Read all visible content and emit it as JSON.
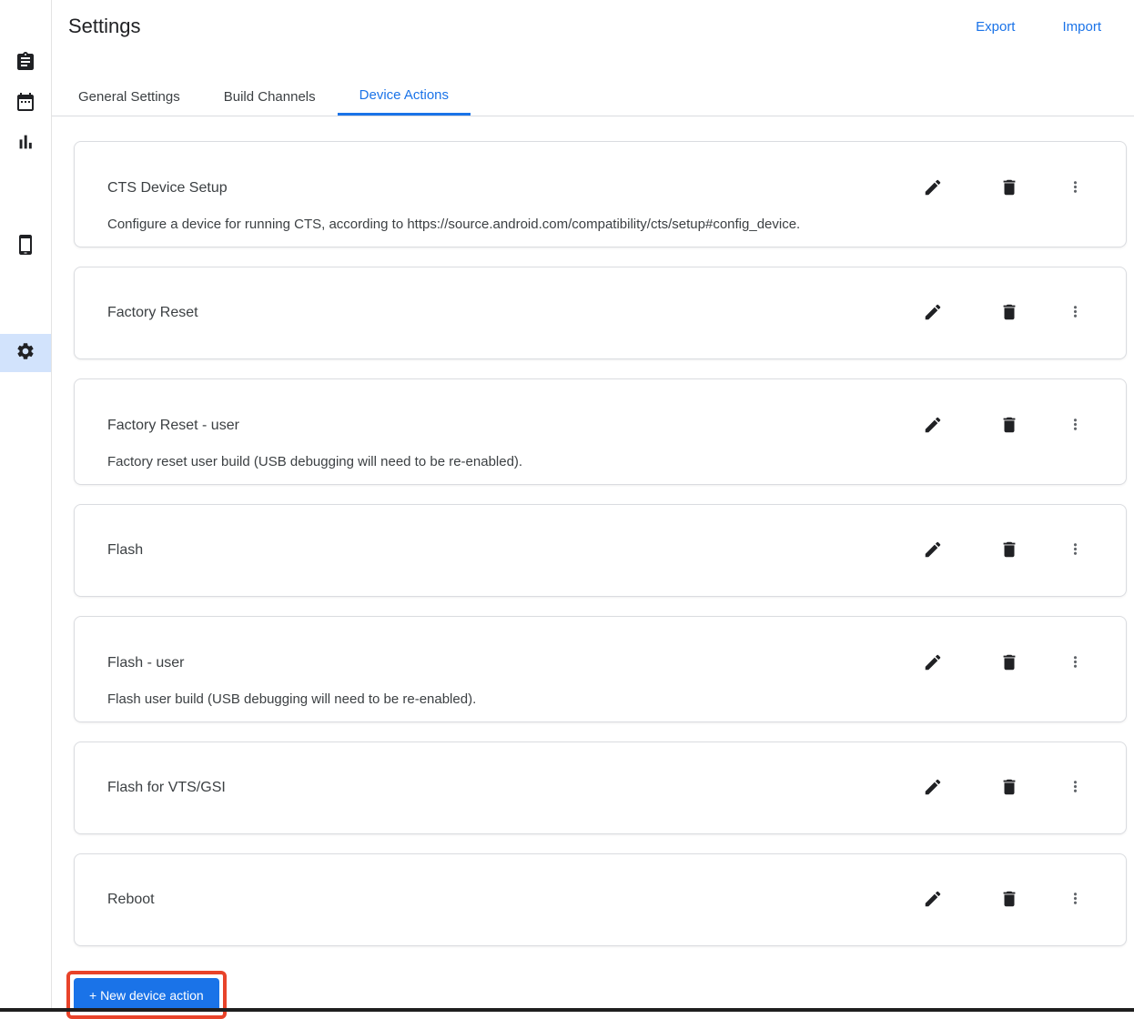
{
  "header": {
    "title": "Settings",
    "actions": [
      {
        "label": "Export"
      },
      {
        "label": "Import"
      }
    ]
  },
  "sidebar": {
    "items": [
      {
        "icon": "assignment-icon",
        "selected": false
      },
      {
        "icon": "calendar-icon",
        "selected": false
      },
      {
        "icon": "bar-chart-icon",
        "selected": false
      },
      {
        "icon": "smartphone-icon",
        "selected": false
      },
      {
        "icon": "gear-icon",
        "selected": true
      }
    ]
  },
  "tabs": [
    {
      "label": "General Settings",
      "active": false
    },
    {
      "label": "Build Channels",
      "active": false
    },
    {
      "label": "Device Actions",
      "active": true
    }
  ],
  "device_actions": [
    {
      "title": "CTS Device Setup",
      "description": "Configure a device for running CTS, according to https://source.android.com/compatibility/cts/setup#config_device."
    },
    {
      "title": "Factory Reset",
      "description": ""
    },
    {
      "title": "Factory Reset - user",
      "description": "Factory reset user build (USB debugging will need to be re-enabled)."
    },
    {
      "title": "Flash",
      "description": ""
    },
    {
      "title": "Flash - user",
      "description": "Flash user build (USB debugging will need to be re-enabled)."
    },
    {
      "title": "Flash for VTS/GSI",
      "description": ""
    },
    {
      "title": "Reboot",
      "description": ""
    }
  ],
  "footer": {
    "new_action_label": "+ New device action"
  },
  "colors": {
    "accent": "#1a73e8",
    "annotation": "#e8432a",
    "selected_bg": "#d2e3fc"
  }
}
